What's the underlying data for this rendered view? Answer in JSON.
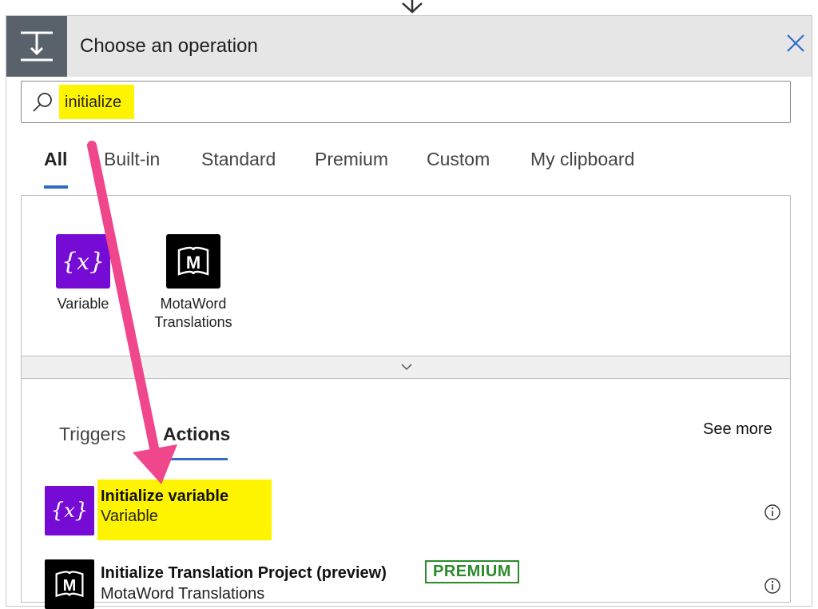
{
  "dialog": {
    "title": "Choose an operation"
  },
  "search": {
    "value": "initialize",
    "placeholder": ""
  },
  "tabs": [
    {
      "label": "All",
      "active": true
    },
    {
      "label": "Built-in",
      "active": false
    },
    {
      "label": "Standard",
      "active": false
    },
    {
      "label": "Premium",
      "active": false
    },
    {
      "label": "Custom",
      "active": false
    },
    {
      "label": "My clipboard",
      "active": false
    }
  ],
  "connectors": [
    {
      "label": "Variable",
      "icon": "variable-icon",
      "color": "#770bd6"
    },
    {
      "label_line1": "MotaWord",
      "label_line2": "Translations",
      "icon": "motaword-icon",
      "color": "#000000"
    }
  ],
  "subtabs": [
    {
      "label": "Triggers",
      "active": false
    },
    {
      "label": "Actions",
      "active": true
    }
  ],
  "see_more": "See more",
  "actions": [
    {
      "title": "Initialize variable",
      "subtitle": "Variable",
      "icon": "variable-icon",
      "color": "#770bd6",
      "highlighted": true
    },
    {
      "title": "Initialize Translation Project (preview)",
      "subtitle": "MotaWord Translations",
      "icon": "motaword-icon",
      "color": "#000000",
      "badge": "PREMIUM"
    }
  ],
  "colors": {
    "accent": "#2f6cc9",
    "highlight": "#fff400",
    "annotation_arrow": "#f0468c",
    "premium": "#2c8a2c"
  }
}
